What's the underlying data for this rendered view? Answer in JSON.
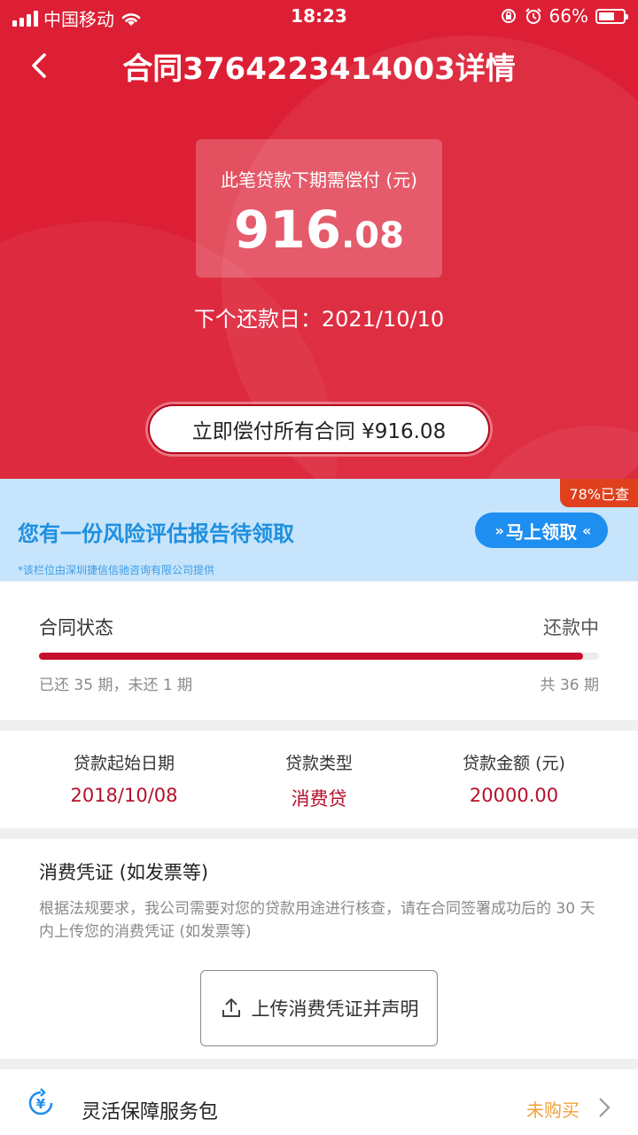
{
  "status_bar": {
    "carrier": "中国移动",
    "time": "18:23",
    "battery": "66%",
    "battery_level": 0.66
  },
  "nav": {
    "title": "合同3764223414003详情"
  },
  "due": {
    "label": "此笔贷款下期需偿付 (元)",
    "amount_int": "916",
    "amount_dec": ".08",
    "next_date_label": "下个还款日：",
    "next_date": "2021/10/10"
  },
  "pay_all_button": "立即偿付所有合同 ¥916.08",
  "risk_banner": {
    "badge": "78%已查",
    "title": "您有一份风险评估报告待领取",
    "button": "马上领取",
    "note": "*该栏位由深圳捷信信驰咨询有限公司提供"
  },
  "contract_status": {
    "label": "合同状态",
    "value": "还款中",
    "paid_text": "已还 35 期，未还 1 期",
    "total_text": "共 36 期",
    "progress": 0.972
  },
  "loan_info": [
    {
      "label": "贷款起始日期",
      "value": "2018/10/08"
    },
    {
      "label": "贷款类型",
      "value": "消费贷"
    },
    {
      "label": "贷款金额 (元)",
      "value": "20000.00"
    }
  ],
  "voucher": {
    "title": "消费凭证 (如发票等)",
    "description": "根据法规要求，我公司需要对您的贷款用途进行核查，请在合同签署成功后的 30 天内上传您的消费凭证 (如发票等)",
    "upload_button": "上传消费凭证并声明"
  },
  "service": {
    "label": "灵活保障服务包",
    "status": "未购买"
  },
  "colors": {
    "brand_red": "#dc1f34",
    "banner_blue": "#1e8ef0",
    "status_orange": "#f0a13c"
  }
}
